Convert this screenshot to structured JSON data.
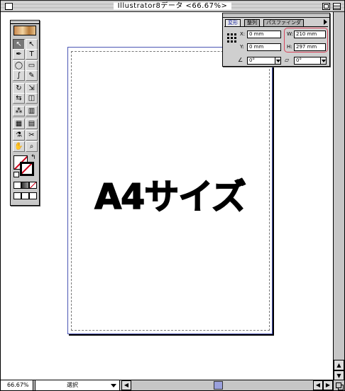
{
  "window": {
    "title": "Illustrator8データ <66.67%>"
  },
  "artboard": {
    "label": "A4サイズ"
  },
  "status_bar": {
    "zoom": "66.67%",
    "tool_status": "選択"
  },
  "toolbox": {
    "tools": [
      {
        "name": "selection-tool",
        "glyph": "↖",
        "selected": true
      },
      {
        "name": "direct-selection-tool",
        "glyph": "↖"
      },
      {
        "name": "pen-tool",
        "glyph": "✒"
      },
      {
        "name": "type-tool",
        "glyph": "T"
      },
      {
        "name": "ellipse-tool",
        "glyph": "◯"
      },
      {
        "name": "rectangle-tool",
        "glyph": "▭"
      },
      {
        "name": "paintbrush-tool",
        "glyph": "∫"
      },
      {
        "name": "pencil-tool",
        "glyph": "✎"
      },
      {
        "name": "rotate-tool",
        "glyph": "↻"
      },
      {
        "name": "scale-tool",
        "glyph": "⇲"
      },
      {
        "name": "reflect-tool",
        "glyph": "⇆"
      },
      {
        "name": "free-transform-tool",
        "glyph": "◫"
      },
      {
        "name": "symbol-tool",
        "glyph": "⁂"
      },
      {
        "name": "graph-tool",
        "glyph": "▥"
      },
      {
        "name": "gradient-mesh-tool",
        "glyph": "▦"
      },
      {
        "name": "gradient-tool",
        "glyph": "▤"
      },
      {
        "name": "eyedropper-tool",
        "glyph": "⚗"
      },
      {
        "name": "scissors-tool",
        "glyph": "✂"
      },
      {
        "name": "hand-tool",
        "glyph": "✋"
      },
      {
        "name": "zoom-tool",
        "glyph": "⌕"
      }
    ]
  },
  "transform_palette": {
    "tabs": [
      "変形",
      "整列",
      "パスファインダ"
    ],
    "active_tab": "変形",
    "x_label": "X:",
    "x_value": "0 mm",
    "y_label": "Y:",
    "y_value": "0 mm",
    "w_label": "W:",
    "w_value": "210 mm",
    "h_label": "H:",
    "h_value": "297 mm",
    "rotate_value": "0°",
    "shear_value": "0°",
    "highlight_color": "#d9435a"
  },
  "colors": {
    "artboard_border": "#4a56b4",
    "scroll_thumb": "#9aa0dc",
    "none_slash": "#d0021b"
  },
  "scrollbar_glyphs": {
    "up": "▲",
    "down": "▼",
    "left": "◀",
    "right": "▶"
  }
}
